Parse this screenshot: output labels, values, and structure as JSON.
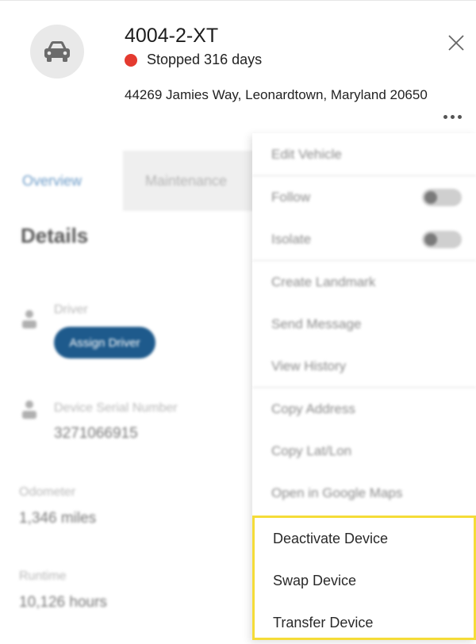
{
  "vehicle": {
    "title": "4004-2-XT",
    "status_text": "Stopped 316 days",
    "status_color": "#e43a2f",
    "address": "44269 Jamies Way, Leonardtown, Maryland 20650",
    "icon": "car-icon"
  },
  "header": {
    "close_icon": "close-icon",
    "more_icon": "more-horizontal-icon"
  },
  "tabs": [
    {
      "label": "Overview",
      "active": true
    },
    {
      "label": "Maintenance",
      "active": false
    }
  ],
  "details": {
    "heading": "Details",
    "driver_label": "Driver",
    "assign_driver_label": "Assign Driver",
    "device_serial_label": "Device Serial Number",
    "device_serial_value": "3271066915",
    "odometer_label": "Odometer",
    "odometer_value": "1,346 miles",
    "runtime_label": "Runtime",
    "runtime_value": "10,126 hours"
  },
  "menu": {
    "edit_vehicle": "Edit Vehicle",
    "follow": "Follow",
    "isolate": "Isolate",
    "create_landmark": "Create Landmark",
    "send_message": "Send Message",
    "view_history": "View History",
    "copy_address": "Copy Address",
    "copy_latlon": "Copy Lat/Lon",
    "open_google_maps": "Open in Google Maps",
    "deactivate_device": "Deactivate Device",
    "swap_device": "Swap Device",
    "transfer_device": "Transfer Device"
  },
  "colors": {
    "accent": "#1e5a8c",
    "highlight": "#f5dc38"
  }
}
